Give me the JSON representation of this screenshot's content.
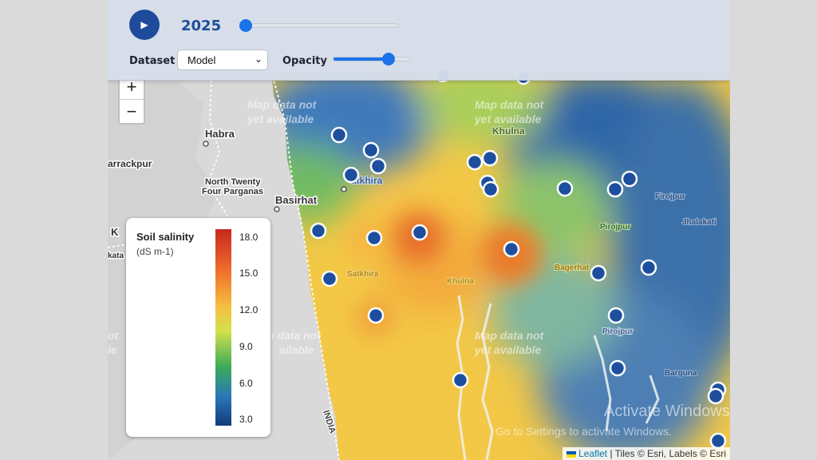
{
  "controls": {
    "play_icon": "play-icon",
    "year": "2025",
    "year_slider_fraction": 0.0,
    "dataset_label": "Dataset",
    "dataset_value": "Model",
    "opacity_label": "Opacity",
    "opacity_fraction": 0.75
  },
  "zoom": {
    "in": "+",
    "out": "−"
  },
  "legend": {
    "title": "Soil salinity",
    "unit": "(dS m-1)",
    "ticks": [
      "18.0",
      "15.0",
      "12.0",
      "9.0",
      "6.0",
      "3.0"
    ],
    "colors": [
      "#c8281e",
      "#ee6a2a",
      "#f5c142",
      "#d2e04c",
      "#3cab57",
      "#2a78b8",
      "#123c7a"
    ]
  },
  "map_labels": {
    "habra": "Habra",
    "barrackpur": "arrackpur",
    "north_twenty_four_1": "North Twenty",
    "north_twenty_four_2": "Four Parganas",
    "basirhat": "Basirhat",
    "khulna_top": "Khulna",
    "satkhira_top": "atkhira",
    "satkhira": "Satkhira",
    "khulna": "Khulna",
    "bagerhat": "Bagerhat",
    "pirojpur": "Pirojpur",
    "pirojpur2": "Pirojpur",
    "firojpur": "Firojpur",
    "jhalakati": "Jhalakati",
    "barguna": "Barguna",
    "india": "INDIA",
    "k_left": "K",
    "kata_left": "kata",
    "map_data_1": "Map data not",
    "map_data_2": "yet available",
    "map_data_3": "Map data not",
    "map_data_4": "yet available",
    "map_data_5": "Map data not",
    "map_data_6": "yet available",
    "map_data_7": "p data not",
    "map_data_8": "ailable",
    "not_left": "ot",
    "le_left": "le"
  },
  "watermark": {
    "line1": "Activate Windows",
    "line2": "Go to Settings to activate Windows."
  },
  "attribution": {
    "leaflet": "Leaflet",
    "rest": "| Tiles © Esri, Labels © Esri"
  }
}
